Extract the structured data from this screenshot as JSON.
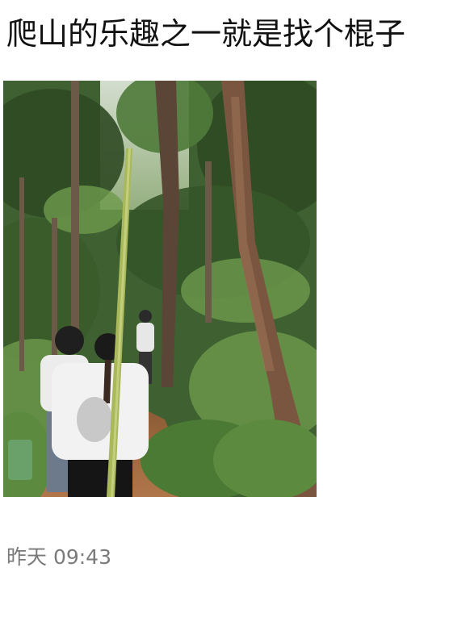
{
  "post": {
    "title": "爬山的乐趣之一就是找个棍子",
    "timestamp": "昨天 09:43"
  },
  "photo": {
    "subject": "forest-trail-hikers",
    "colors": {
      "foliage_dark": "#2f4a24",
      "foliage_mid": "#4f7a3a",
      "foliage_light": "#8fb46a",
      "sky": "#dfe7dc",
      "trail": "#a26a3c",
      "bark": "#6b4a35",
      "bamboo": "#a9b85a"
    }
  }
}
